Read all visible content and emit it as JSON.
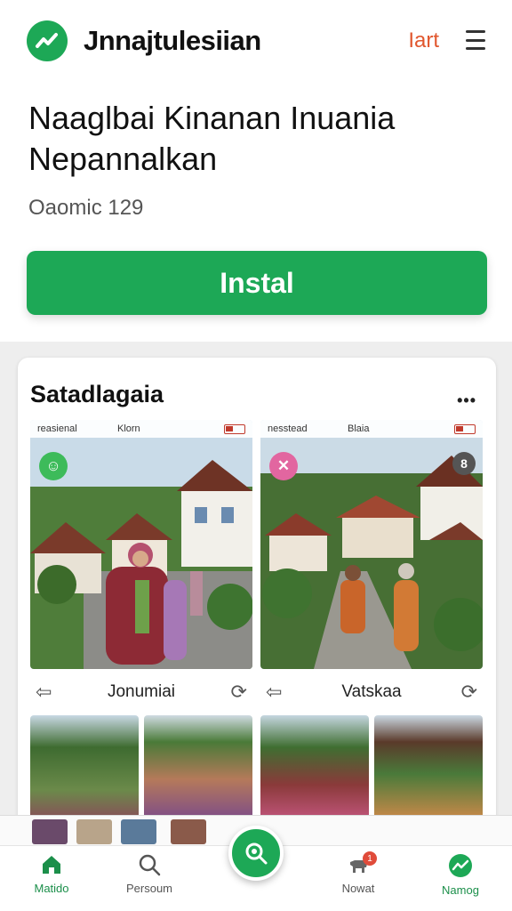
{
  "header": {
    "app_name": "Jnnajtulesiian",
    "lang_label": "Iart",
    "brand_color": "#1da856"
  },
  "listing": {
    "title": "Naaglbai Kinanan Inuania Nepannalkan",
    "meta": "Oaomic 129",
    "install_label": "Instal"
  },
  "gallery": {
    "title": "Satadlagaia",
    "more_label": "•••",
    "screens": [
      {
        "status_left": "reasienal",
        "status_mid": "Klorn",
        "caption": "Jonumiai",
        "badge_icon": "leaf-icon",
        "badge_color": "#3dbb5a",
        "badge_glyph": "☺"
      },
      {
        "status_left": "nesstead",
        "status_mid": "Blaia",
        "caption": "Vatskaa",
        "badge_icon": "close-icon",
        "badge_color": "#e266a0",
        "badge_glyph": "✕"
      }
    ],
    "right_badge_glyph": "8",
    "back_glyph": "⇦",
    "share_glyph": "⟳"
  },
  "bottom_nav": {
    "items": [
      {
        "label": "Matido",
        "icon": "home-icon",
        "active": true
      },
      {
        "label": "Persoum",
        "icon": "search-icon",
        "active": false
      },
      {
        "label": "Nowat",
        "icon": "animal-icon",
        "active": false,
        "badge": "1"
      },
      {
        "label": "Namog",
        "icon": "trend-icon",
        "active": true
      }
    ]
  }
}
